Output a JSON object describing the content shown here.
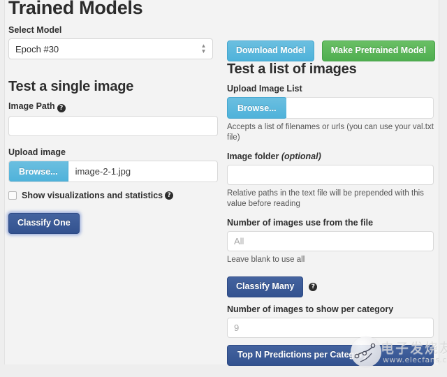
{
  "page": {
    "title": "Trained Models"
  },
  "model_select": {
    "label": "Select Model",
    "value": "Epoch #30",
    "options": [
      "Epoch #30"
    ],
    "arrow_up": "▲",
    "arrow_down": "▼"
  },
  "top_buttons": {
    "download_model": "Download Model",
    "make_pretrained": "Make Pretrained Model"
  },
  "single_image": {
    "heading": "Test a single image",
    "image_path": {
      "label": "Image Path",
      "value": "",
      "placeholder": "",
      "help_glyph": "?"
    },
    "upload_image": {
      "label": "Upload image",
      "browse_label": "Browse...",
      "file_name": "image-2-1.jpg"
    },
    "show_visualizations": {
      "label": "Show visualizations and statistics",
      "checked": false,
      "help_glyph": "?"
    },
    "classify_one_label": "Classify One"
  },
  "image_list": {
    "heading": "Test a list of images",
    "upload_list": {
      "label": "Upload Image List",
      "browse_label": "Browse...",
      "help_text": "Accepts a list of filenames or urls (you can use your val.txt file)"
    },
    "image_folder": {
      "label": "Image folder",
      "label_optional": "(optional)",
      "value": "",
      "placeholder": "",
      "help_text": "Relative paths in the text file will be prepended with this value before reading"
    },
    "num_images_file": {
      "label": "Number of images use from the file",
      "value": "",
      "placeholder": "All",
      "help_text": "Leave blank to use all"
    },
    "classify_many_label": "Classify Many",
    "classify_many_help_glyph": "?",
    "num_images_category": {
      "label": "Number of images to show per category",
      "value": "",
      "placeholder": "9"
    },
    "top_n_label": "Top N Predictions per Category"
  },
  "watermark": {
    "text": "电子发烧友",
    "url": "www.elecfans.com"
  },
  "colors": {
    "info": "#5bb8dd",
    "success": "#5cb85c",
    "primary": "#3b5ea8",
    "page_bg": "#eeeeee",
    "panel_bg": "#f3f3f3"
  }
}
